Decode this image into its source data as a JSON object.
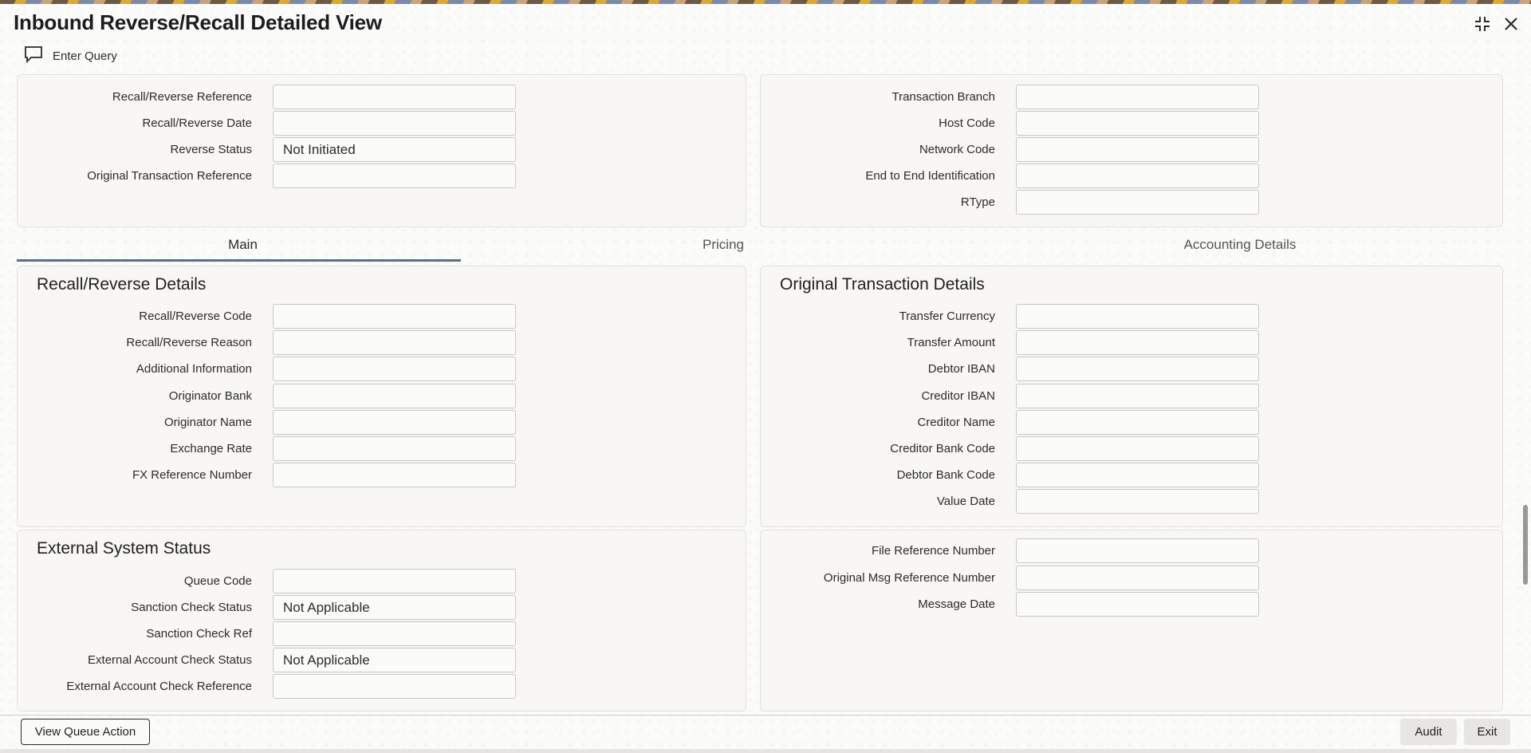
{
  "window": {
    "title": "Inbound Reverse/Recall Detailed View",
    "controls": [
      "collapse-icon",
      "close-icon"
    ]
  },
  "toolbar": {
    "enter_query": "Enter Query",
    "icon": "comment-icon"
  },
  "header": {
    "left": [
      {
        "label": "Recall/Reverse Reference",
        "value": ""
      },
      {
        "label": "Recall/Reverse Date",
        "value": ""
      },
      {
        "label": "Reverse Status",
        "value": "Not Initiated"
      },
      {
        "label": "Original Transaction Reference",
        "value": ""
      }
    ],
    "right": [
      {
        "label": "Transaction Branch",
        "value": ""
      },
      {
        "label": "Host Code",
        "value": ""
      },
      {
        "label": "Network Code",
        "value": ""
      },
      {
        "label": "End to End Identification",
        "value": ""
      },
      {
        "label": "RType",
        "value": ""
      }
    ]
  },
  "tabs": [
    {
      "label": "Main",
      "active": true
    },
    {
      "label": "Pricing",
      "active": false
    },
    {
      "label": "Accounting Details",
      "active": false
    }
  ],
  "recall_details": {
    "title": "Recall/Reverse Details",
    "fields": [
      {
        "label": "Recall/Reverse Code",
        "value": ""
      },
      {
        "label": "Recall/Reverse Reason",
        "value": ""
      },
      {
        "label": "Additional Information",
        "value": ""
      },
      {
        "label": "Originator Bank",
        "value": ""
      },
      {
        "label": "Originator Name",
        "value": ""
      },
      {
        "label": "Exchange Rate",
        "value": ""
      },
      {
        "label": "FX Reference Number",
        "value": ""
      }
    ]
  },
  "original_txn": {
    "title": "Original Transaction Details",
    "fields": [
      {
        "label": "Transfer Currency",
        "value": ""
      },
      {
        "label": "Transfer Amount",
        "value": ""
      },
      {
        "label": "Debtor IBAN",
        "value": ""
      },
      {
        "label": "Creditor IBAN",
        "value": ""
      },
      {
        "label": "Creditor Name",
        "value": ""
      },
      {
        "label": "Creditor Bank Code",
        "value": ""
      },
      {
        "label": "Debtor Bank Code",
        "value": ""
      },
      {
        "label": "Value Date",
        "value": ""
      }
    ]
  },
  "external_status": {
    "title": "External System Status",
    "fields": [
      {
        "label": "Queue Code",
        "value": ""
      },
      {
        "label": "Sanction Check Status",
        "value": "Not Applicable"
      },
      {
        "label": "Sanction Check Ref",
        "value": ""
      },
      {
        "label": "External Account Check Status",
        "value": "Not Applicable"
      },
      {
        "label": "External Account Check Reference",
        "value": ""
      }
    ]
  },
  "file_info": {
    "fields": [
      {
        "label": "File Reference Number",
        "value": ""
      },
      {
        "label": "Original Msg Reference Number",
        "value": ""
      },
      {
        "label": "Message Date",
        "value": ""
      }
    ]
  },
  "footer": {
    "view_queue_action": "View Queue Action",
    "audit": "Audit",
    "exit": "Exit"
  }
}
